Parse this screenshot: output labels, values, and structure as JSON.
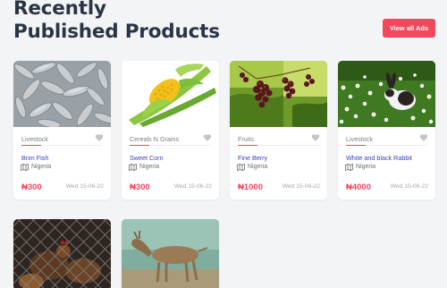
{
  "section": {
    "title_line1": "Recently",
    "title_line2": "Published Products",
    "view_all_label": "View all Ads"
  },
  "products": [
    {
      "category": "Livestock",
      "title": "Brim Fish",
      "location": "Nigeria",
      "price": "₦300",
      "date": "Wed 15-06-22"
    },
    {
      "category": "Cereals N Grains",
      "title": "Sweet Corn",
      "location": "Nigeria",
      "price": "₦300",
      "date": "Wed 15-06-22"
    },
    {
      "category": "Fruits",
      "title": "Fine Berry",
      "location": "Nigeria",
      "price": "₦1000",
      "date": "Wed 15-06-22"
    },
    {
      "category": "Livestock",
      "title": "White and black Rabbit",
      "location": "Nigeria",
      "price": "₦4000",
      "date": "Wed 15-06-22"
    }
  ],
  "colors": {
    "accent": "#f2475d",
    "title_link": "#3b43b5",
    "heading": "#2b3445",
    "background": "#f3f4f6"
  },
  "icons": {
    "favorite": "heart-icon",
    "location": "map-icon"
  }
}
